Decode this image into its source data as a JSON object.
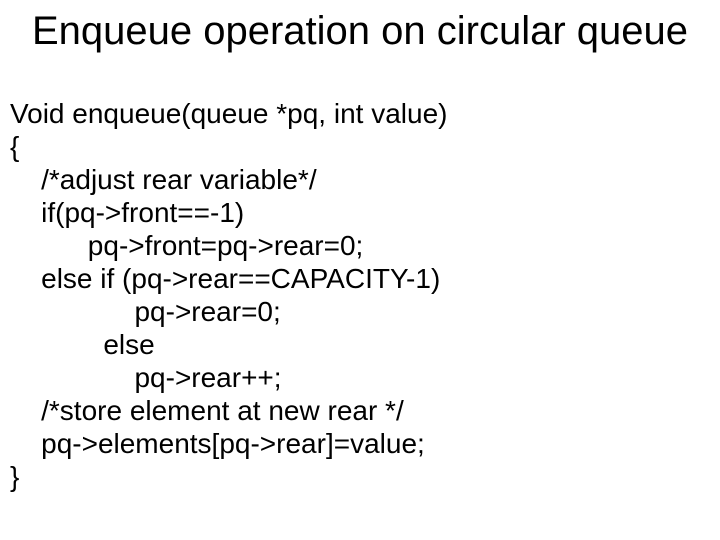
{
  "slide": {
    "title": "Enqueue operation on circular\nqueue",
    "lines": {
      "l0": "Void enqueue(queue *pq, int value)",
      "l1": "{",
      "l2": "    /*adjust rear variable*/",
      "l3": "    if(pq->front==-1)",
      "l4": "          pq->front=pq->rear=0;",
      "l5": "    else if (pq->rear==CAPACITY-1)",
      "l6": "                pq->rear=0;",
      "l7": "            else",
      "l8": "                pq->rear++;",
      "l9": "    /*store element at new rear */",
      "l10": "    pq->elements[pq->rear]=value;",
      "l11": "}"
    }
  }
}
